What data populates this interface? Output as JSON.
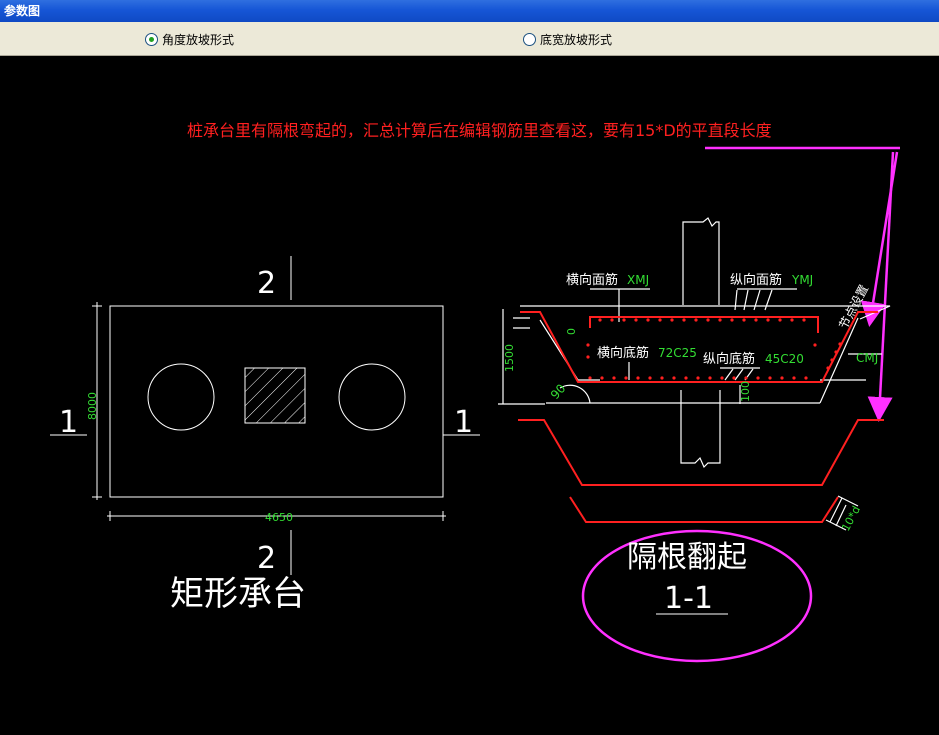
{
  "window": {
    "title": "参数图"
  },
  "options": [
    {
      "label": "角度放坡形式",
      "selected": true
    },
    {
      "label": "底宽放坡形式",
      "selected": false
    }
  ],
  "annotation": {
    "text": "桩承台里有隔根弯起的，汇总计算后在编辑钢筋里查看这，要有15*D的平直段长度",
    "color": "#ff2020",
    "arrow_color": "#ff30ff"
  },
  "plan": {
    "section_top": "2",
    "section_bottom": "2",
    "section_left": "1",
    "section_right": "1",
    "dim_height": "8000",
    "dim_width": "4650",
    "caption": "矩形承台"
  },
  "section": {
    "top_rebar_x": "横向面筋",
    "top_rebar_x_code": "XMJ",
    "top_rebar_y": "纵向面筋",
    "top_rebar_y_code": "YMJ",
    "bottom_rebar_x": "横向底筋",
    "bottom_rebar_x_code": "72C25",
    "bottom_rebar_y": "纵向底筋",
    "bottom_rebar_y_code": "45C20",
    "side_rebar": "节点设置",
    "side_rebar_code": "CMJ",
    "dim_depth": "1500",
    "dim_zero": "0",
    "dim_cover": "100",
    "angle": "90",
    "bend_length": "10*d",
    "caption_main": "隔根翻起",
    "caption_sub": "1-1"
  }
}
